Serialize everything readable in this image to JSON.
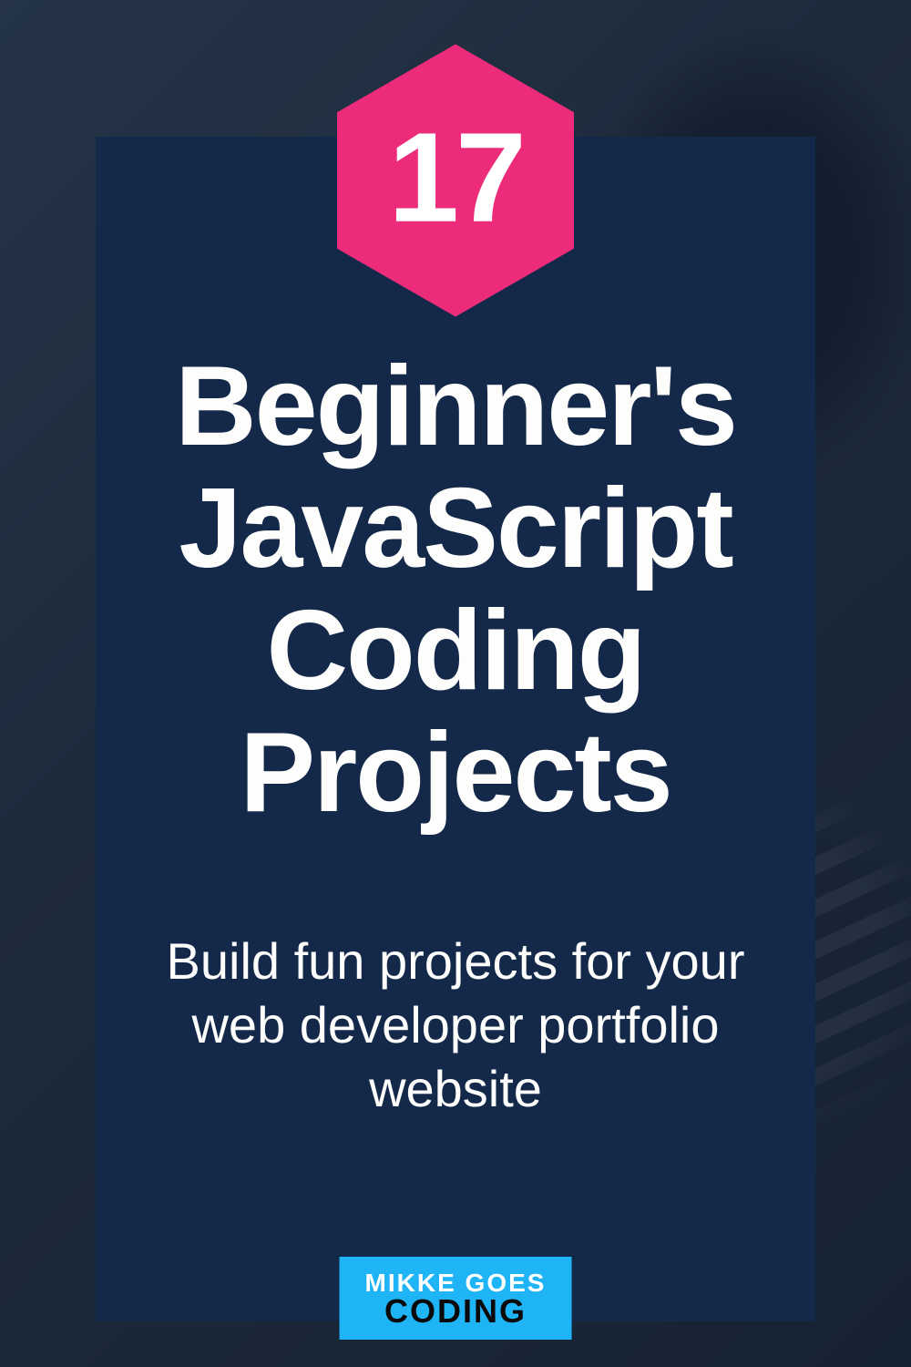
{
  "badge_number": "17",
  "title_text": "Beginner's JavaScript Coding Projects",
  "subtitle_text": "Build fun projects for your web developer portfolio website",
  "logo": {
    "line1": "MIKKE GOES",
    "line2": "CODING"
  },
  "colors": {
    "hex": "#ec2c7a",
    "card": "#14284a",
    "logo_bg": "#1eb4f5"
  }
}
